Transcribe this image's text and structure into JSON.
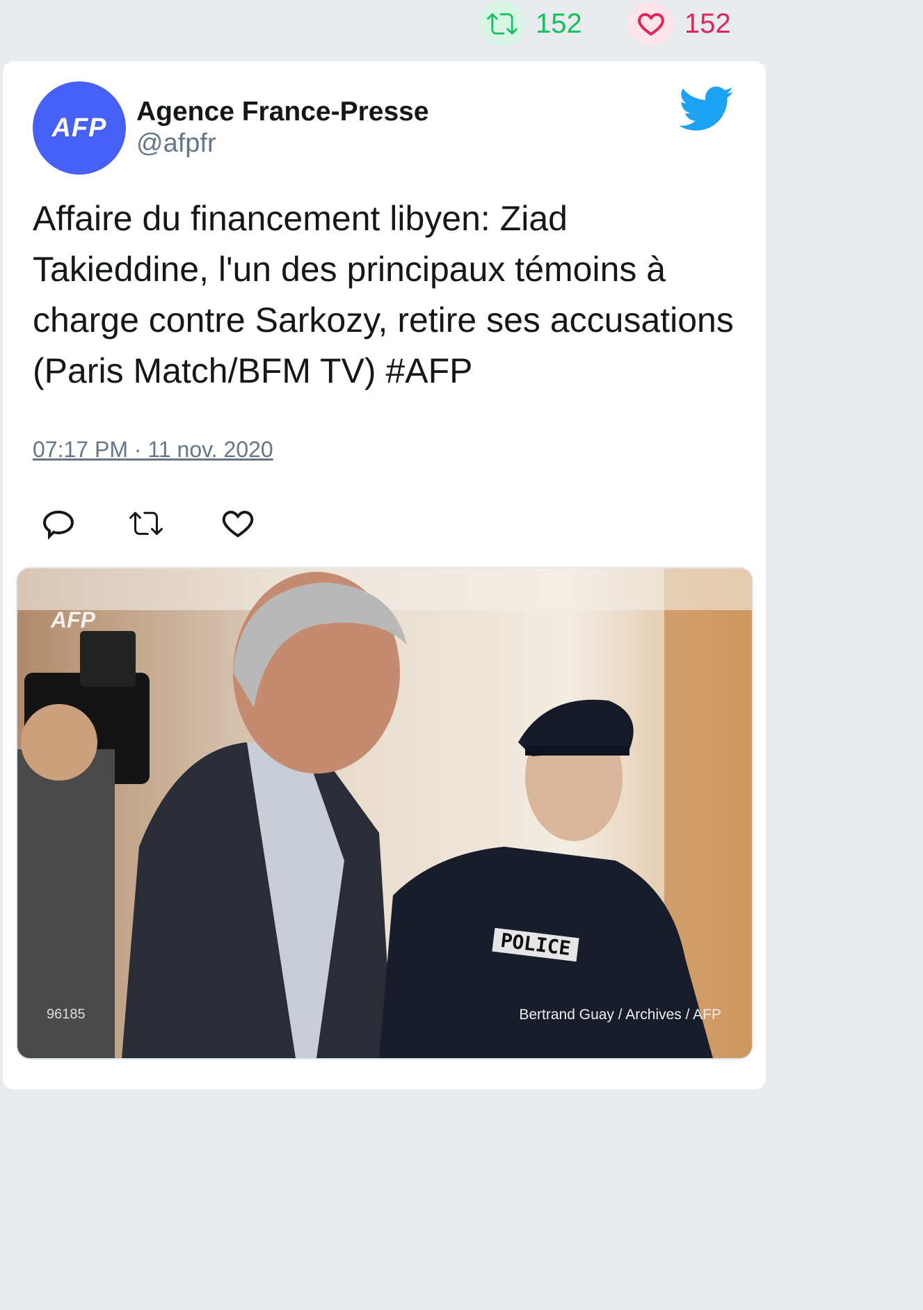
{
  "stats": {
    "retweets": "152",
    "likes": "152",
    "retweet_color": "#17bf63",
    "like_color": "#e0245e"
  },
  "author": {
    "avatar_text": "AFP",
    "avatar_color": "#4660f5",
    "name": "Agence France-Presse",
    "handle": "@afpfr",
    "brand_icon": "twitter-bird-icon",
    "brand_color": "#1da1f2"
  },
  "tweet": {
    "text": "Affaire du financement libyen: Ziad Takieddine, l'un des principaux témoins à charge contre Sarkozy, retire ses accusations (Paris Match/BFM TV) #AFP",
    "timestamp": "07:17 PM · 11 nov. 2020"
  },
  "actions": [
    "reply-icon",
    "retweet-icon",
    "like-icon"
  ],
  "media": {
    "watermark": "AFP",
    "photo_id": "96185",
    "credit": "Bertrand Guay / Archives / AFP",
    "badge_text": "POLICE"
  }
}
